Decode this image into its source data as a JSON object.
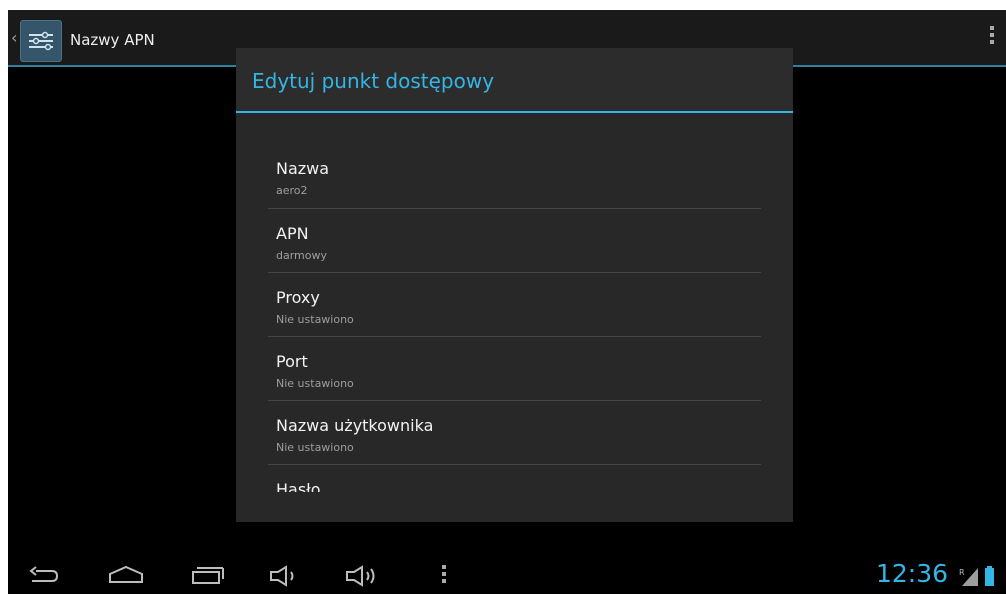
{
  "action_bar": {
    "title": "Nazwy APN",
    "up_caret": "‹",
    "app_icon": "settings-sliders-icon",
    "overflow_icon": "overflow-menu-icon"
  },
  "dialog": {
    "title": "Edytuj punkt dostępowy",
    "accent_color": "#33b5e5",
    "items": [
      {
        "title": "Nazwa",
        "summary": "aero2"
      },
      {
        "title": "APN",
        "summary": "darmowy"
      },
      {
        "title": "Proxy",
        "summary": "Nie ustawiono"
      },
      {
        "title": "Port",
        "summary": "Nie ustawiono"
      },
      {
        "title": "Nazwa użytkownika",
        "summary": "Nie ustawiono"
      },
      {
        "title": "Hasło",
        "summary": ""
      }
    ]
  },
  "nav_bar": {
    "buttons": [
      "back-icon",
      "home-icon",
      "recent-apps-icon",
      "volume-down-icon",
      "volume-up-icon",
      "menu-icon"
    ]
  },
  "status_bar": {
    "time": "12:36",
    "signal_label": "R",
    "icons": [
      "signal-icon",
      "battery-icon"
    ]
  }
}
